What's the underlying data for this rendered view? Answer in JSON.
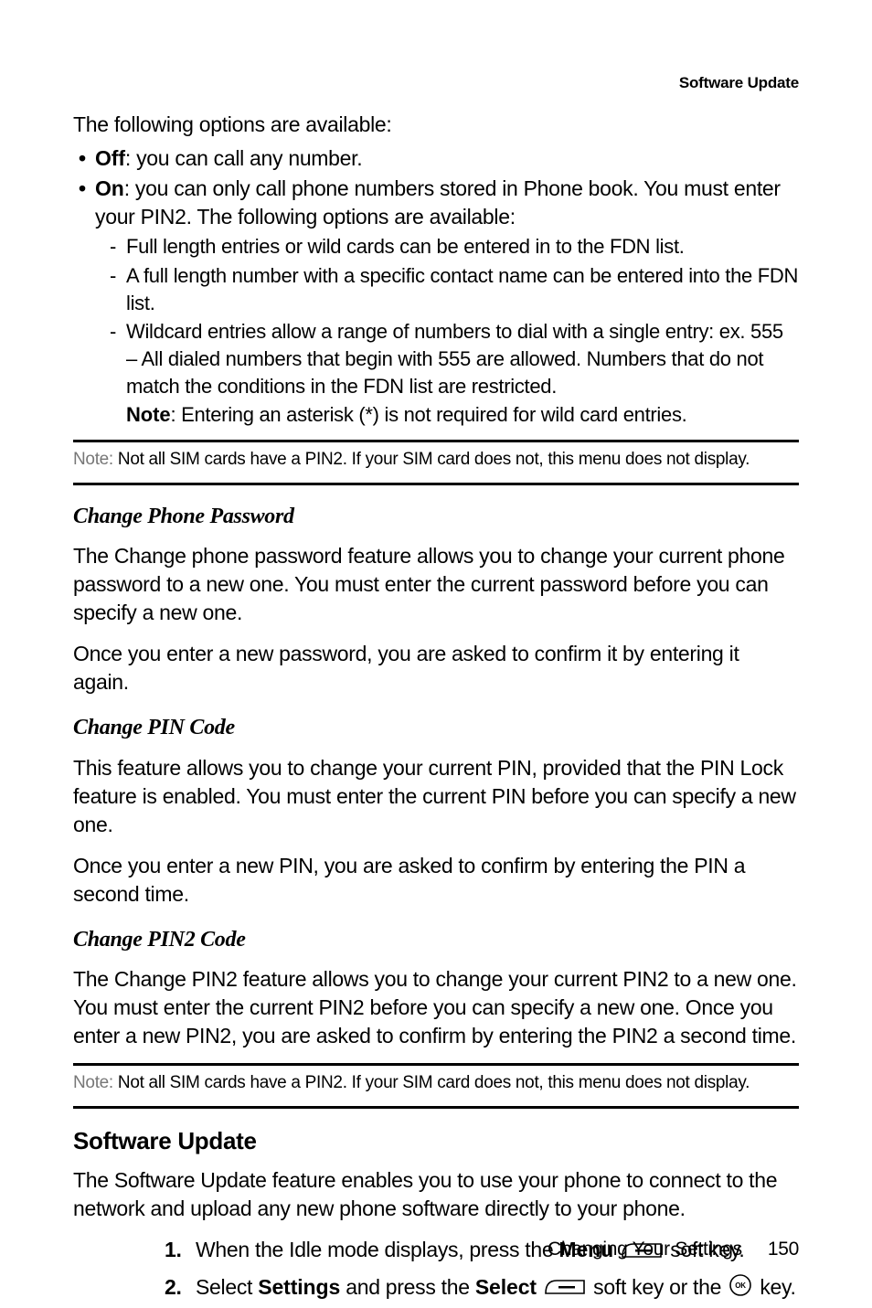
{
  "header": "Software Update",
  "intro": "The following options are available:",
  "bullets": [
    {
      "label": "Off",
      "text": ": you can call any number."
    },
    {
      "label": "On",
      "text": ": you can only call phone numbers stored in Phone book. You must enter your PIN2. The following options are available:"
    }
  ],
  "sub_bullets": [
    "Full length entries or wild cards can be entered in to the FDN list.",
    "A full length number with a specific contact name can be entered into the FDN list.",
    "Wildcard entries allow a range of numbers to dial with a single entry: ex. 555 – All dialed numbers that begin with 555 are allowed. Numbers that do not match the conditions in the FDN list are restricted."
  ],
  "note_inline_label": "Note",
  "note_inline_text": ": Entering an asterisk (*) is not required for wild card entries.",
  "note1_label": "Note: ",
  "note1_text": "Not all SIM cards have a PIN2. If your SIM card does not, this menu does not display.",
  "h_change_phone": "Change Phone Password",
  "p_change_phone": "The Change phone password feature allows you to change your current phone password to a new one. You must enter the current password before you can specify a new one.",
  "p_change_phone2": "Once you enter a new password, you are asked to confirm it by entering it again.",
  "h_change_pin": "Change PIN Code",
  "p_change_pin": "This feature allows you to change your current PIN, provided that the PIN Lock feature is enabled. You must enter the current PIN before you can specify a new one.",
  "p_change_pin2": "Once you enter a new PIN, you are asked to confirm by entering the PIN a second time.",
  "h_change_pin2": "Change PIN2 Code",
  "p_change_pin2_body": "The Change PIN2 feature allows you to change your current PIN2 to a new one. You must enter the current PIN2 before you can specify a new one. Once you enter a new PIN2, you are asked to confirm by entering the PIN2 a second time.",
  "note2_label": "Note: ",
  "note2_text": "Not all SIM cards have a PIN2. If your SIM card does not, this menu does not display.",
  "h_software": "Software Update",
  "p_software": "The Software Update feature enables you to use your phone to connect to the network and upload any new phone software directly to your phone.",
  "steps": {
    "s1_num": "1.",
    "s1_a": "When the Idle mode displays, press the ",
    "s1_menu": "Menu",
    "s1_b": " soft key.",
    "s2_num": "2.",
    "s2_a": "Select ",
    "s2_settings": "Settings",
    "s2_b": " and press the ",
    "s2_select": "Select",
    "s2_c": " soft key or the ",
    "s2_d": " key."
  },
  "footer_text": "Changing Your Settings",
  "footer_page": "150"
}
